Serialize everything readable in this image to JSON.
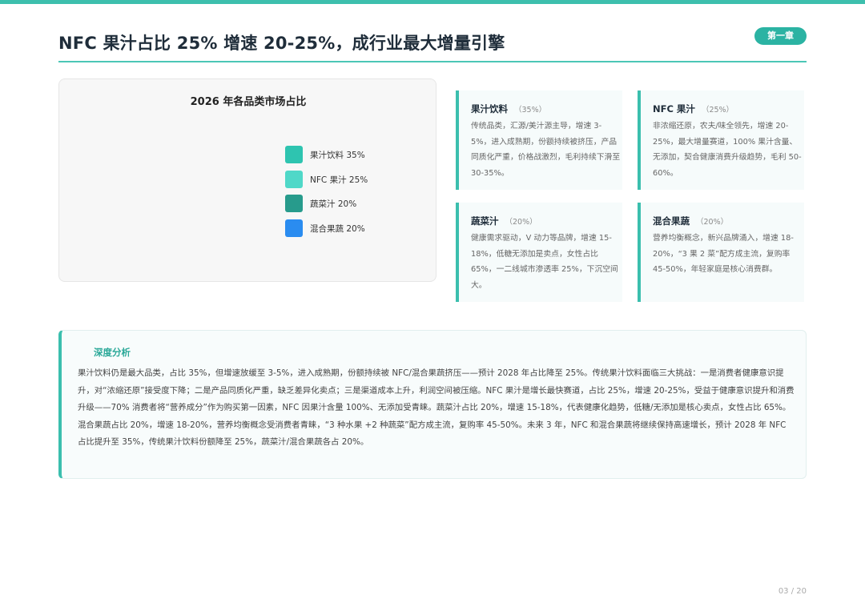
{
  "header": {
    "title": "NFC 果汁占比 25% 增速 20-25%，成行业最大增量引擎",
    "chapter": "第一章"
  },
  "chart_data": {
    "type": "pie",
    "title": "2026 年各品类市场占比",
    "categories": [
      "果汁饮料",
      "NFC 果汁",
      "蔬菜汁",
      "混合果蔬"
    ],
    "values": [
      35,
      25,
      20,
      20
    ],
    "legend_labels": [
      "果汁饮料 35%",
      "NFC 果汁 25%",
      "蔬菜汁 20%",
      "混合果蔬 20%"
    ],
    "colors": [
      "#2ec4b0",
      "#4fd8c8",
      "#279b8c",
      "#2a8cf0"
    ],
    "legend_position": "right"
  },
  "cards": [
    {
      "title": "果汁饮料",
      "share": "（35%）",
      "body": "传统品类，汇源/美汁源主导，增速 3-5%，进入成熟期，份额持续被挤压，产品同质化严重，价格战激烈，毛利持续下滑至 30-35%。"
    },
    {
      "title": "NFC 果汁",
      "share": "（25%）",
      "body": "非浓缩还原，农夫/味全领先，增速 20-25%，最大增量赛道，100% 果汁含量、无添加，契合健康消费升级趋势，毛利 50-60%。"
    },
    {
      "title": "蔬菜汁",
      "share": "（20%）",
      "body": "健康需求驱动，V 动力等品牌，增速 15-18%，低糖无添加是卖点，女性占比 65%，一二线城市渗透率 25%，下沉空间大。"
    },
    {
      "title": "混合果蔬",
      "share": "（20%）",
      "body": "营养均衡概念，新兴品牌涌入，增速 18-20%，“3 果 2 菜”配方成主流，复购率 45-50%，年轻家庭是核心消费群。"
    }
  ],
  "analysis": {
    "title": "深度分析",
    "body": "果汁饮料仍是最大品类，占比 35%，但增速放缓至 3-5%，进入成熟期，份额持续被 NFC/混合果蔬挤压——预计 2028 年占比降至 25%。传统果汁饮料面临三大挑战：一是消费者健康意识提升，对“浓缩还原”接受度下降；二是产品同质化严重，缺乏差异化卖点；三是渠道成本上升，利润空间被压缩。NFC 果汁是增长最快赛道，占比 25%，增速 20-25%，受益于健康意识提升和消费升级——70% 消费者将“营养成分”作为购买第一因素，NFC 因果汁含量 100%、无添加受青睐。蔬菜汁占比 20%，增速 15-18%，代表健康化趋势，低糖/无添加是核心卖点，女性占比 65%。混合果蔬占比 20%，增速 18-20%，营养均衡概念受消费者青睐，“3 种水果 +2 种蔬菜”配方成主流，复购率 45-50%。未来 3 年，NFC 和混合果蔬将继续保持高速增长，预计 2028 年 NFC 占比提升至 35%，传统果汁饮料份额降至 25%，蔬菜汁/混合果蔬各占 20%。"
  },
  "footer": {
    "page": "03 / 20"
  }
}
